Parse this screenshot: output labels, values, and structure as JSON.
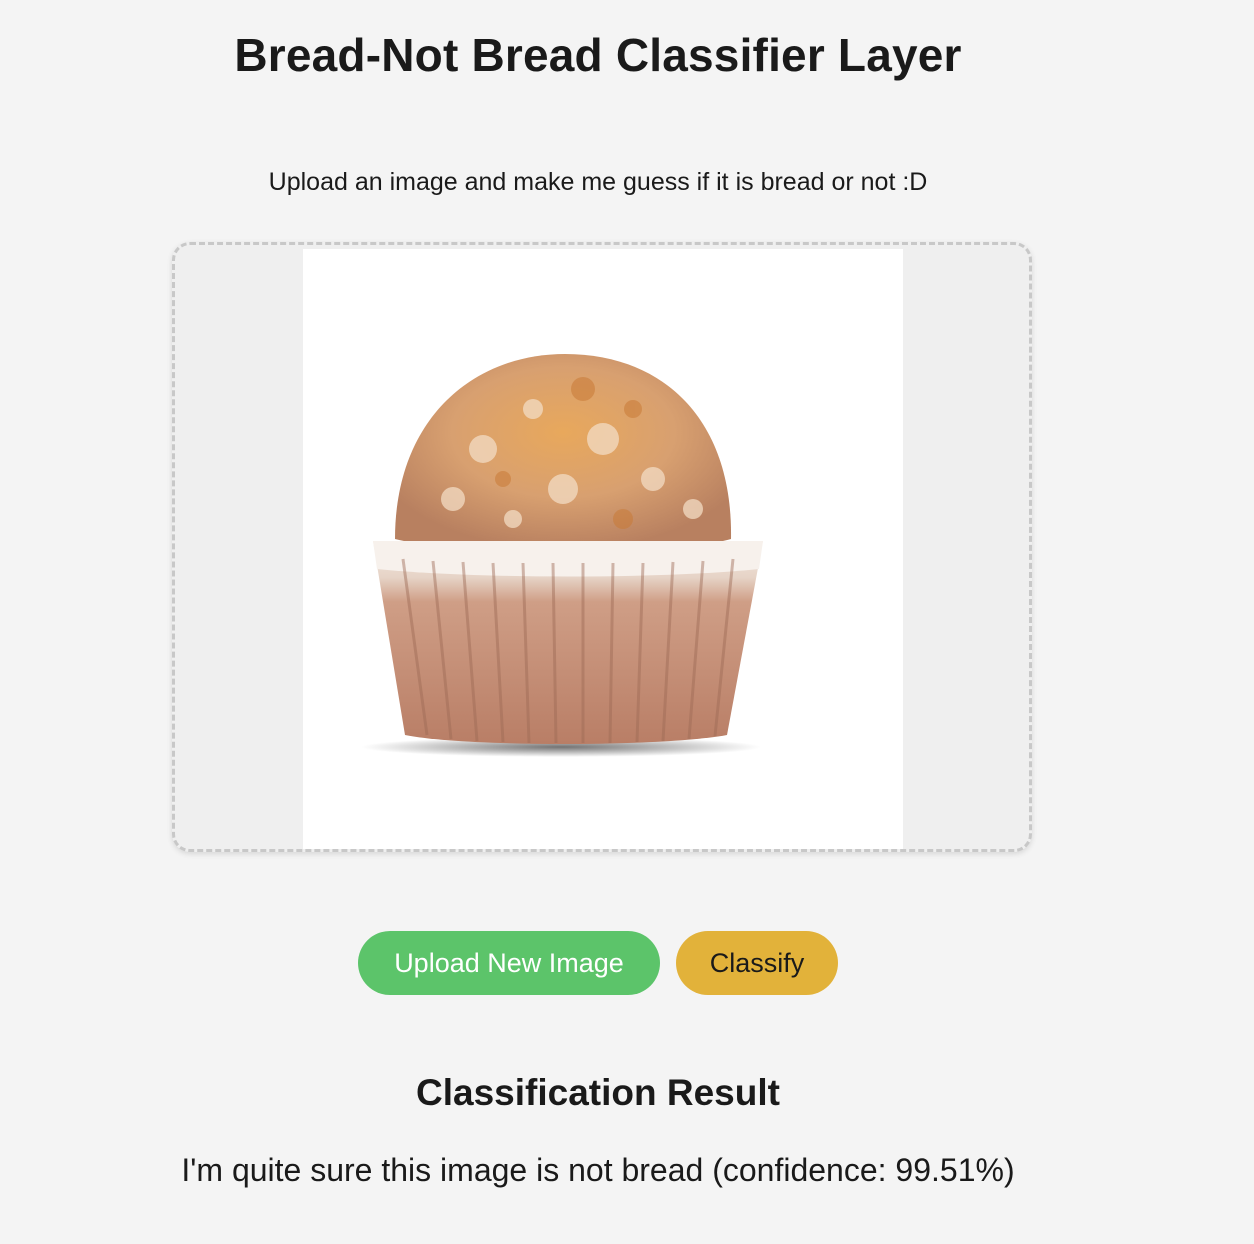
{
  "header": {
    "title": "Bread-Not Bread Classifier Layer",
    "subtitle": "Upload an image and make me guess if it is bread or not :D"
  },
  "upload_area": {
    "image_content": "muffin-photo"
  },
  "actions": {
    "upload_label": "Upload New Image",
    "classify_label": "Classify"
  },
  "result": {
    "heading": "Classification Result",
    "message": "I'm quite sure this image is not bread (confidence: 99.51%)"
  },
  "colors": {
    "background": "#f4f4f4",
    "upload_button": "#5cc46a",
    "classify_button": "#e2b23a",
    "dropzone_border": "#c8c8c8"
  }
}
